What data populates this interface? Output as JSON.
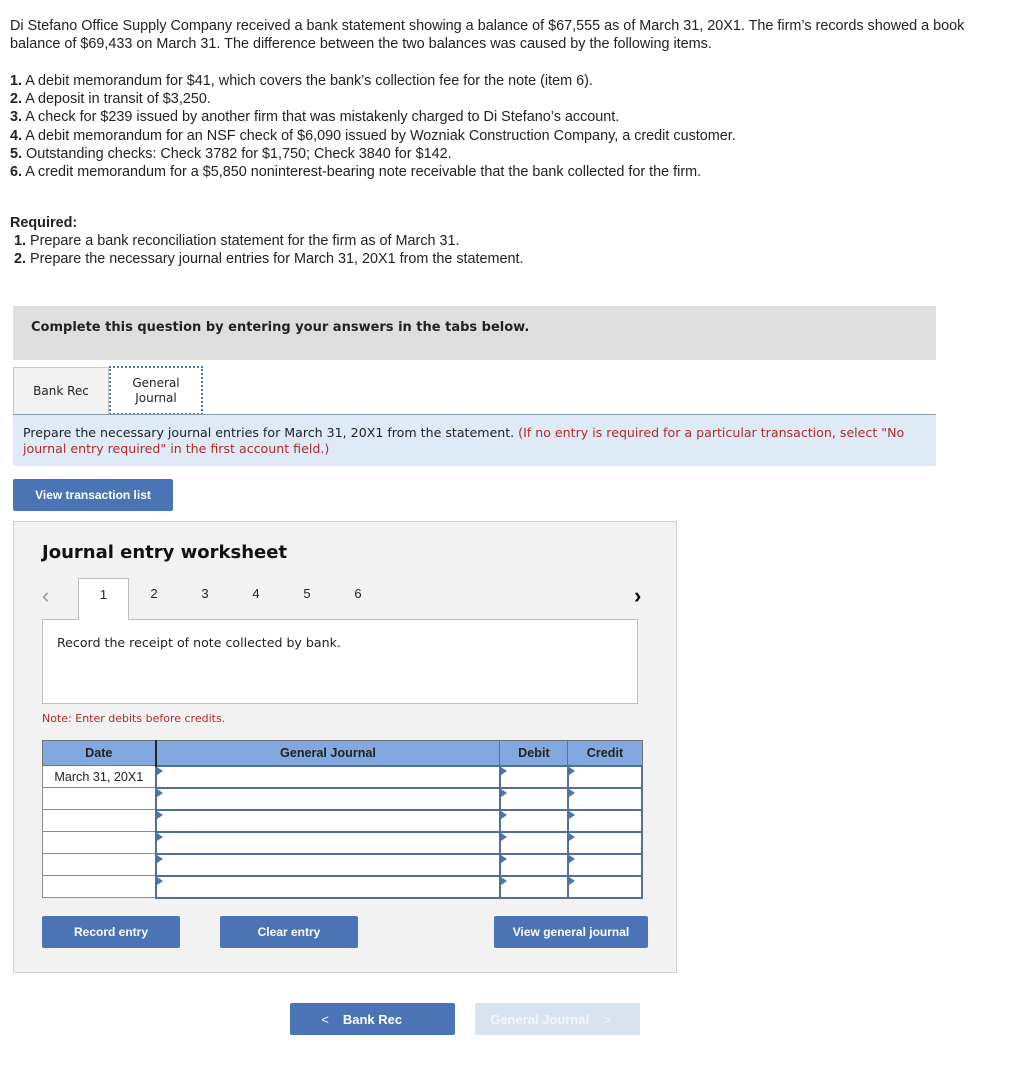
{
  "problem": {
    "intro": "Di Stefano Office Supply Company received a bank statement showing a balance of $67,555 as of March 31, 20X1. The firm’s records showed a book balance of $69,433 on March 31. The difference between the two balances was caused by the following items.",
    "items": [
      {
        "num": "1.",
        "text": " A debit memorandum for $41, which covers the bank’s collection fee for the note (item 6)."
      },
      {
        "num": "2.",
        "text": " A deposit in transit of $3,250."
      },
      {
        "num": "3.",
        "text": " A check for $239 issued by another firm that was mistakenly charged to Di Stefano’s account."
      },
      {
        "num": "4.",
        "text": " A debit memorandum for an NSF check of $6,090 issued by Wozniak Construction Company, a credit customer."
      },
      {
        "num": "5.",
        "text": " Outstanding checks: Check 3782 for $1,750; Check 3840 for $142."
      },
      {
        "num": "6.",
        "text": " A credit memorandum for a $5,850 noninterest-bearing note receivable that the bank collected for the firm."
      }
    ]
  },
  "required": {
    "title": "Required:",
    "items": [
      {
        "num": "1.",
        "text": " Prepare a bank reconciliation statement for the firm as of March 31."
      },
      {
        "num": "2.",
        "text": " Prepare the necessary journal entries for March 31, 20X1 from the statement."
      }
    ]
  },
  "complete_bar": "Complete this question by entering your answers in the tabs below.",
  "tabs": [
    {
      "label": "Bank Rec",
      "active": false
    },
    {
      "label_line1": "General",
      "label_line2": "Journal",
      "active": true
    }
  ],
  "instructions": {
    "main": "Prepare the necessary journal entries for March 31, 20X1 from the statement. ",
    "note": "(If no entry is required for a particular transaction, select \"No journal entry required\" in the first account field.)"
  },
  "buttons": {
    "view_transaction_list": "View transaction list",
    "record_entry": "Record entry",
    "clear_entry": "Clear entry",
    "view_general_journal": "View general journal",
    "nav_prev": "Bank Rec",
    "nav_next": "General Journal"
  },
  "worksheet": {
    "title": "Journal entry worksheet",
    "pages": [
      "1",
      "2",
      "3",
      "4",
      "5",
      "6"
    ],
    "active_page": "1",
    "prev_icon": "‹",
    "next_icon": "›",
    "description": "Record the receipt of note collected by bank.",
    "note": "Note: Enter debits before credits.",
    "columns": [
      "Date",
      "General Journal",
      "Debit",
      "Credit"
    ],
    "rows": [
      {
        "date": "March 31, 20X1",
        "account": "",
        "debit": "",
        "credit": ""
      },
      {
        "date": "",
        "account": "",
        "debit": "",
        "credit": ""
      },
      {
        "date": "",
        "account": "",
        "debit": "",
        "credit": ""
      },
      {
        "date": "",
        "account": "",
        "debit": "",
        "credit": ""
      },
      {
        "date": "",
        "account": "",
        "debit": "",
        "credit": ""
      },
      {
        "date": "",
        "account": "",
        "debit": "",
        "credit": ""
      }
    ]
  }
}
